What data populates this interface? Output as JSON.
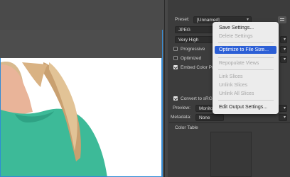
{
  "preset": {
    "label": "Preset:",
    "value": "[Unnamed]"
  },
  "format": {
    "value": "JPEG"
  },
  "quality_level": {
    "value": "Very High"
  },
  "options": {
    "progressive": {
      "label": "Progressive",
      "checked": false
    },
    "optimized": {
      "label": "Optimized",
      "checked": false
    },
    "embed_color_profile": {
      "label": "Embed Color Pr",
      "checked": true
    },
    "convert_srgb": {
      "label": "Convert to sRG",
      "checked": true
    }
  },
  "preview": {
    "label": "Preview:",
    "value": "Monitor C"
  },
  "metadata": {
    "label": "Metadata:",
    "value": "None"
  },
  "color_table": {
    "label": "Color Table"
  },
  "menu": {
    "items": [
      {
        "label": "Save Settings...",
        "state": "enabled"
      },
      {
        "label": "Delete Settings",
        "state": "disabled"
      },
      {
        "label": "Optimize to File Size...",
        "state": "highlighted"
      },
      {
        "label": "Repopulate Views",
        "state": "disabled"
      },
      {
        "label": "Link Slices",
        "state": "disabled"
      },
      {
        "label": "Unlink Slices",
        "state": "disabled"
      },
      {
        "label": "Unlink All Slices",
        "state": "disabled"
      },
      {
        "label": "Edit Output Settings...",
        "state": "enabled"
      }
    ]
  },
  "icons": {
    "panel_menu": "panel-menu-icon",
    "dropdown": "chevron-down-icon"
  },
  "colors": {
    "accent": "#2c5fd6",
    "shirt": "#3dba98",
    "doc_border": "#2f8bd6"
  }
}
